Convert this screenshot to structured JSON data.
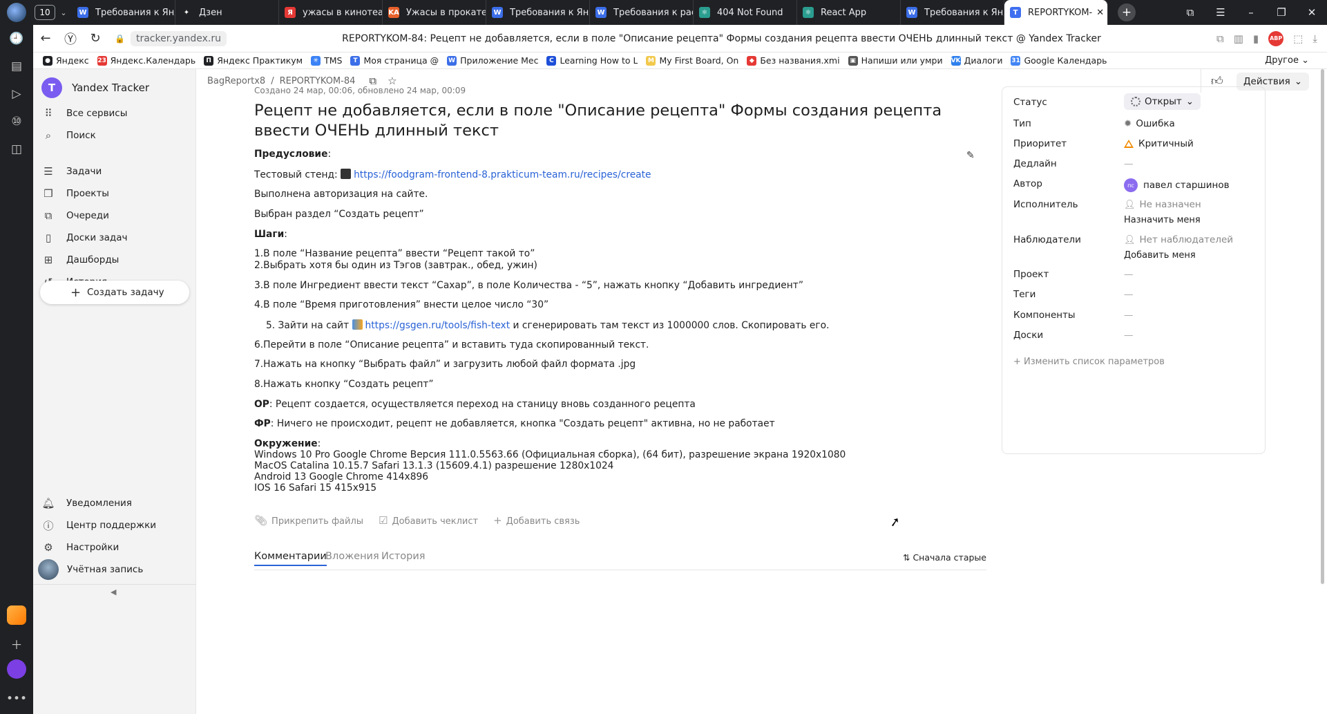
{
  "browser": {
    "tab_counter": "10",
    "tabs": [
      {
        "label": "Требования к Янд",
        "color": "#3b6ee8",
        "glyph": "W"
      },
      {
        "label": "Дзен",
        "color": "#202124",
        "glyph": "✦"
      },
      {
        "label": "ужасы в кинотеат",
        "color": "#e53935",
        "glyph": "Я"
      },
      {
        "label": "Ужасы в прокате",
        "color": "#e8612c",
        "glyph": "KA"
      },
      {
        "label": "Требования к Янд",
        "color": "#3b6ee8",
        "glyph": "W"
      },
      {
        "label": "Требования к рас",
        "color": "#3b6ee8",
        "glyph": "W"
      },
      {
        "label": "404 Not Found",
        "color": "#2a9d8f",
        "glyph": "⚛"
      },
      {
        "label": "React App",
        "color": "#2a9d8f",
        "glyph": "⚛"
      },
      {
        "label": "Требования к Янд",
        "color": "#3b6ee8",
        "glyph": "W"
      },
      {
        "label": "REPORTYKOM-",
        "color": "#3f6ff0",
        "glyph": "T",
        "active": true
      }
    ],
    "url": "tracker.yandex.ru",
    "page_title": "REPORTYKOM-84: Рецепт не добавляется, если в поле \"Описание рецепта\" Формы создания рецепта ввести ОЧЕНЬ длинный текст @ Yandex Tracker",
    "bookmarks": [
      {
        "label": "Яндекс",
        "color": "#202124",
        "glyph": "●"
      },
      {
        "label": "Яндекс.Календарь",
        "color": "#e53935",
        "glyph": "23"
      },
      {
        "label": "Яндекс Практикум",
        "color": "#202124",
        "glyph": "П"
      },
      {
        "label": "TMS",
        "color": "#3b82f6",
        "glyph": "✳"
      },
      {
        "label": "Моя страница @",
        "color": "#3b6ee8",
        "glyph": "T"
      },
      {
        "label": "Приложение Мес",
        "color": "#3b6ee8",
        "glyph": "W"
      },
      {
        "label": "Learning How to L",
        "color": "#1e4fd8",
        "glyph": "C"
      },
      {
        "label": "My First Board, On",
        "color": "#f2c94c",
        "glyph": "M"
      },
      {
        "label": "Без названия.xmi",
        "color": "#e53935",
        "glyph": "◆"
      },
      {
        "label": "Напиши или умри",
        "color": "#555555",
        "glyph": "▣"
      },
      {
        "label": "Диалоги",
        "color": "#2f80ed",
        "glyph": "VK"
      },
      {
        "label": "Google Календарь",
        "color": "#4285f4",
        "glyph": "31"
      }
    ],
    "bookmarks_other": "Другое"
  },
  "sidebar": {
    "brand": "Yandex Tracker",
    "top_items": [
      {
        "label": "Все сервисы",
        "icon": "grid-icon"
      },
      {
        "label": "Поиск",
        "icon": "search-icon"
      }
    ],
    "items": [
      {
        "label": "Задачи",
        "icon": "tasks-icon"
      },
      {
        "label": "Проекты",
        "icon": "projects-icon"
      },
      {
        "label": "Очереди",
        "icon": "queues-icon"
      },
      {
        "label": "Доски задач",
        "icon": "boards-icon"
      },
      {
        "label": "Дашборды",
        "icon": "dashboards-icon"
      },
      {
        "label": "История",
        "icon": "history-icon"
      }
    ],
    "create_label": "Создать задачу",
    "bottom_items": [
      {
        "label": "Уведомления",
        "icon": "bell-icon"
      },
      {
        "label": "Центр поддержки",
        "icon": "help-icon"
      },
      {
        "label": "Настройки",
        "icon": "gear-icon"
      },
      {
        "label": "Учётная запись",
        "icon": "avatar"
      }
    ]
  },
  "header": {
    "breadcrumb_queue": "BagReportx8",
    "breadcrumb_key": "REPORTYKOM-84",
    "actions_label": "Действия"
  },
  "issue": {
    "meta": "Создано 24 мар, 00:06, обновлено 24 мар, 00:09",
    "title": "Рецепт не добавляется, если в поле \"Описание рецепта\" Формы создания рецепта ввести ОЧЕНЬ длинный текст",
    "precondition_label": "Предусловие",
    "stand_prefix": "Тестовый стенд: ",
    "stand_link": "https://foodgram-frontend-8.prakticum-team.ru/recipes/create",
    "auth_line": "Выполнена авторизация на сайте.",
    "section_line": "Выбран раздел “Создать рецепт”",
    "steps_label": "Шаги",
    "step1": "1.В поле “Название рецепта” ввести “Рецепт такой то”",
    "step2": "2.Выбрать хотя бы один из Тэгов (завтрак., обед, ужин)",
    "step3": "3.В поле Ингредиент ввести текст “Сахар”, в поле Количества - “5”, нажать кнопку “Добавить ингредиент”",
    "step4": "4.В поле “Время приготовления” внести целое число “30”",
    "step5_prefix": "5. Зайти на сайт ",
    "step5_link": "https://gsgen.ru/tools/fish-text",
    "step5_suffix": " и сгенерировать там текст из 1000000 слов. Скопировать его.",
    "step6": "6.Перейти в поле “Описание рецепта” и вставить туда скопированный текст.",
    "step7": "7.Нажать на кнопку “Выбрать файл” и загрузить любой файл формата .jpg",
    "step8": "8.Нажать кнопку “Создать рецепт”",
    "or_label": "ОР",
    "or_text": ": Рецепт создается, осуществляется переход на станицу вновь созданного рецепта",
    "fr_label": "ФР",
    "fr_text": ": Ничего не происходит, рецепт не добавляется, кнопка \"Создать рецепт\" активна, но не работает",
    "env_label": "Окружение",
    "env1": "Windows 10 Pro Google Chrome Версия 111.0.5563.66 (Официальная сборка), (64 бит), разрешение экрана 1920x1080",
    "env2": "MacOS Catalina 10.15.7 Safari 13.1.3 (15609.4.1) разрешение 1280x1024",
    "env3": "Android 13 Google Chrome 414x896",
    "env4": "IOS 16 Safari 15 415x915"
  },
  "attach_actions": {
    "files": "Прикрепить файлы",
    "checklist": "Добавить чеклист",
    "link": "Добавить связь"
  },
  "bottom_tabs": {
    "comments": "Комментарии",
    "attachments": "Вложения",
    "history": "История",
    "sort": "Сначала старые"
  },
  "params": {
    "status_label": "Статус",
    "status_value": "Открыт",
    "type_label": "Тип",
    "type_value": "Ошибка",
    "priority_label": "Приоритет",
    "priority_value": "Критичный",
    "deadline_label": "Дедлайн",
    "deadline_value": "—",
    "author_label": "Автор",
    "author_initials": "пс",
    "author_value": "павел старшинов",
    "assignee_label": "Исполнитель",
    "assignee_value": "Не назначен",
    "assign_me": "Назначить меня",
    "followers_label": "Наблюдатели",
    "followers_value": "Нет наблюдателей",
    "add_follower": "Добавить меня",
    "project_label": "Проект",
    "project_value": "—",
    "tags_label": "Теги",
    "tags_value": "—",
    "components_label": "Компоненты",
    "components_value": "—",
    "boards_label": "Доски",
    "boards_value": "—",
    "change_params": "Изменить список параметров"
  }
}
